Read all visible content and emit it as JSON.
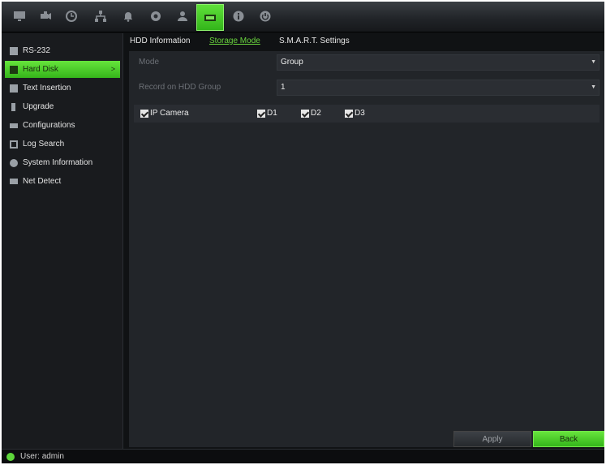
{
  "topbar": {
    "icons": [
      "monitor-icon",
      "camera-icon",
      "clock-icon",
      "network-icon",
      "bell-icon",
      "record-icon",
      "user-icon",
      "device-icon",
      "info-icon",
      "power-icon"
    ],
    "accent": "#4fcb2a"
  },
  "sidebar": {
    "items": [
      {
        "label": "RS-232",
        "icon": "rs232-icon"
      },
      {
        "label": "Hard Disk",
        "icon": "hard-disk-icon"
      },
      {
        "label": "Text Insertion",
        "icon": "text-insertion-icon"
      },
      {
        "label": "Upgrade",
        "icon": "upgrade-icon"
      },
      {
        "label": "Configurations",
        "icon": "configurations-icon"
      },
      {
        "label": "Log Search",
        "icon": "log-search-icon"
      },
      {
        "label": "System Information",
        "icon": "system-info-icon"
      },
      {
        "label": "Net Detect",
        "icon": "net-detect-icon"
      }
    ],
    "active_index": 1,
    "active_arrow": ">"
  },
  "tabs": [
    {
      "label": "HDD Information"
    },
    {
      "label": "Storage Mode"
    },
    {
      "label": "S.M.A.R.T. Settings"
    }
  ],
  "form": {
    "mode_label": "Mode",
    "mode_value": "Group",
    "group_label": "Record on HDD Group",
    "group_value": "1"
  },
  "cameras": {
    "main_label": "IP Camera",
    "main_checked": true,
    "items": [
      {
        "label": "D1",
        "checked": true
      },
      {
        "label": "D2",
        "checked": true
      },
      {
        "label": "D3",
        "checked": true
      }
    ]
  },
  "buttons": {
    "apply": "Apply",
    "back": "Back"
  },
  "status": {
    "user_prefix": "User:",
    "user_name": "admin"
  }
}
